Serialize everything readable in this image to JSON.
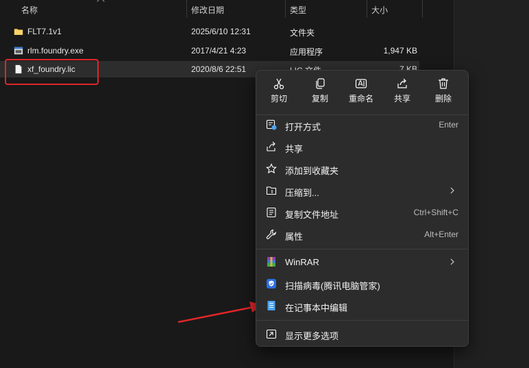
{
  "columns": {
    "name": "名称",
    "date": "修改日期",
    "type": "类型",
    "size": "大小"
  },
  "files": [
    {
      "name": "FLT7.1v1",
      "date": "2025/6/10 12:31",
      "type": "文件夹",
      "size": "",
      "icon": "folder-icon"
    },
    {
      "name": "rlm.foundry.exe",
      "date": "2017/4/21 4:23",
      "type": "应用程序",
      "size": "1,947 KB",
      "icon": "app-icon"
    },
    {
      "name": "xf_foundry.lic",
      "date": "2020/8/6 22:51",
      "type": "LIC 文件",
      "size": "7 KB",
      "icon": "file-icon"
    }
  ],
  "context_menu": {
    "quick_actions": [
      {
        "label": "剪切",
        "icon": "scissors-icon"
      },
      {
        "label": "复制",
        "icon": "copy-icon"
      },
      {
        "label": "重命名",
        "icon": "rename-icon"
      },
      {
        "label": "共享",
        "icon": "share-icon"
      },
      {
        "label": "删除",
        "icon": "trash-icon"
      }
    ],
    "items": [
      {
        "label": "打开方式",
        "shortcut": "Enter",
        "icon": "open-with-icon"
      },
      {
        "label": "共享",
        "shortcut": "",
        "icon": "share-icon"
      },
      {
        "label": "添加到收藏夹",
        "shortcut": "",
        "icon": "star-icon"
      },
      {
        "label": "压缩到...",
        "shortcut": "",
        "icon": "zip-folder-icon",
        "submenu": true
      },
      {
        "label": "复制文件地址",
        "shortcut": "Ctrl+Shift+C",
        "icon": "copy-path-icon"
      },
      {
        "label": "属性",
        "shortcut": "Alt+Enter",
        "icon": "wrench-icon"
      },
      {
        "label": "WinRAR",
        "shortcut": "",
        "icon": "winrar-icon",
        "submenu": true
      },
      {
        "label": "扫描病毒(腾讯电脑管家)",
        "shortcut": "",
        "icon": "shield-icon"
      },
      {
        "label": "在记事本中编辑",
        "shortcut": "",
        "icon": "notepad-icon"
      },
      {
        "label": "显示更多选项",
        "shortcut": "",
        "icon": "more-options-icon"
      }
    ]
  },
  "colors": {
    "background": "#191919",
    "menu_bg": "#2c2c2c",
    "annotation_red": "#e0262a",
    "folder_yellow": "#f5c342",
    "accent_blue": "#4aa3f0"
  }
}
